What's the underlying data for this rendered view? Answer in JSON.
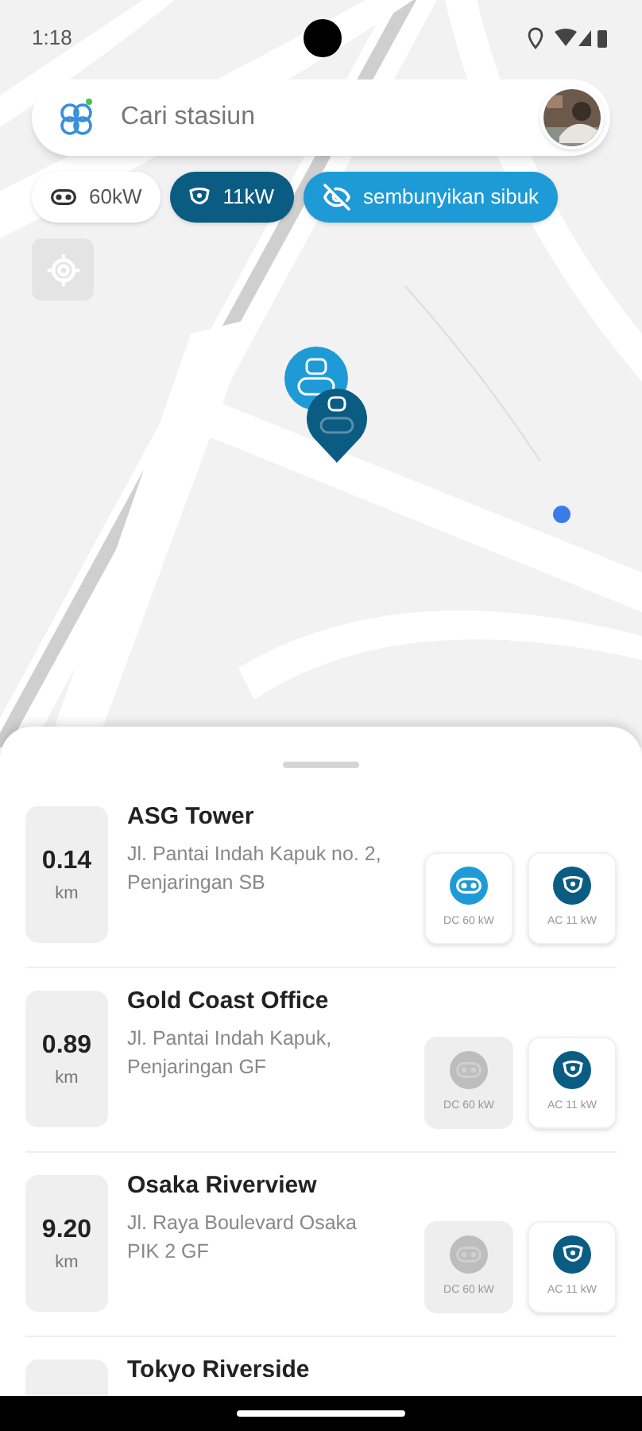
{
  "status_bar": {
    "time": "1:18"
  },
  "search": {
    "placeholder": "Cari stasiun"
  },
  "filters": [
    {
      "kind": "dc",
      "label": "60kW",
      "selected": false
    },
    {
      "kind": "ac",
      "label": "11kW",
      "selected": true
    },
    {
      "kind": "hide",
      "label": "sembunyikan sibuk",
      "selected": true
    }
  ],
  "stations": [
    {
      "distance": "0.14",
      "unit": "km",
      "name": "ASG Tower",
      "address": "Jl. Pantai Indah Kapuk no. 2,\nPenjaringan SB",
      "connectors": [
        {
          "kind": "dc",
          "label": "DC 60 kW",
          "available": true
        },
        {
          "kind": "ac",
          "label": "AC 11 kW",
          "available": true
        }
      ]
    },
    {
      "distance": "0.89",
      "unit": "km",
      "name": "Gold Coast Office",
      "address": "Jl. Pantai Indah Kapuk,\nPenjaringan GF",
      "connectors": [
        {
          "kind": "dc",
          "label": "DC 60 kW",
          "available": false
        },
        {
          "kind": "ac",
          "label": "AC 11 kW",
          "available": true
        }
      ]
    },
    {
      "distance": "9.20",
      "unit": "km",
      "name": "Osaka Riverview",
      "address": "Jl. Raya Boulevard Osaka\nPIK 2 GF",
      "connectors": [
        {
          "kind": "dc",
          "label": "DC 60 kW",
          "available": false
        },
        {
          "kind": "ac",
          "label": "AC 11 kW",
          "available": true
        }
      ]
    },
    {
      "name": "Tokyo Riverside"
    }
  ]
}
